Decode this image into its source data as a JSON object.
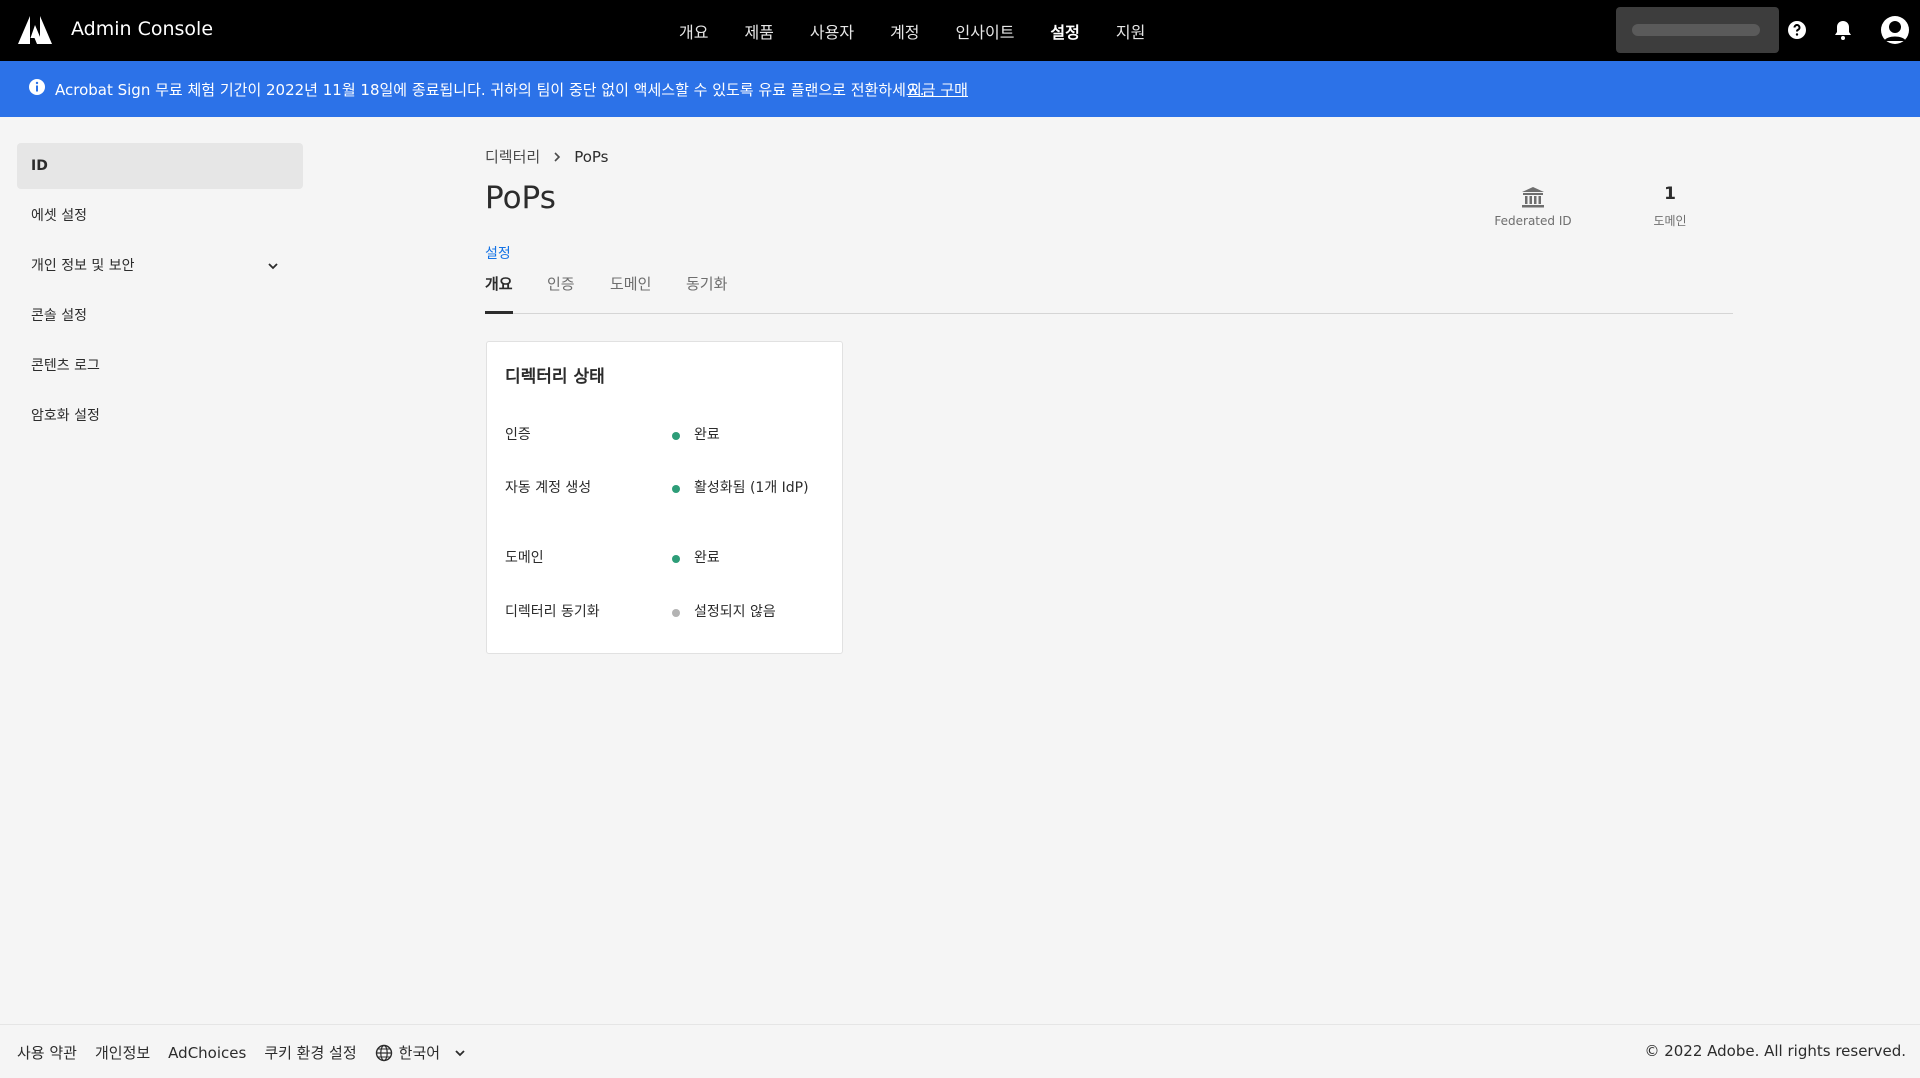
{
  "header": {
    "app_title": "Admin Console",
    "nav": [
      "개요",
      "제품",
      "사용자",
      "계정",
      "인사이트",
      "설정",
      "지원"
    ],
    "active_nav_index": 5
  },
  "banner": {
    "text": "Acrobat Sign 무료 체험 기간이 2022년 11월 18일에 종료됩니다. 귀하의 팀이 중단 없이 액세스할 수 있도록 유료 플랜으로 전환하세요.",
    "link": "지금 구매",
    "color": "#2c72e8"
  },
  "sidebar": {
    "items": [
      {
        "label": "ID",
        "active": true
      },
      {
        "label": "에셋 설정"
      },
      {
        "label": "개인 정보 및 보안",
        "expandable": true
      },
      {
        "label": "콘솔 설정"
      },
      {
        "label": "콘텐츠 로그"
      },
      {
        "label": "암호화 설정"
      }
    ]
  },
  "breadcrumb": {
    "parent": "디렉터리",
    "current": "PoPs"
  },
  "page_title": "PoPs",
  "stats": {
    "federated": {
      "label": "Federated ID"
    },
    "domains": {
      "value": "1",
      "label": "도메인"
    }
  },
  "section_link": "설정",
  "tabs": [
    {
      "label": "개요",
      "active": true
    },
    {
      "label": "인증"
    },
    {
      "label": "도메인"
    },
    {
      "label": "동기화"
    }
  ],
  "status_card": {
    "title": "디렉터리 상태",
    "rows": [
      {
        "label": "인증",
        "status": "완료",
        "state": "ok"
      },
      {
        "label": "자동 계정 생성",
        "status": "활성화됨 (1개 IdP)",
        "state": "ok"
      },
      {
        "label": "도메인",
        "status": "완료",
        "state": "ok"
      },
      {
        "label": "디렉터리 동기화",
        "status": "설정되지 않음",
        "state": "none"
      }
    ],
    "colors": {
      "ok": "#2d9d78",
      "none": "#b3b3b3"
    }
  },
  "footer": {
    "links": [
      "사용 약관",
      "개인정보",
      "AdChoices",
      "쿠키 환경 설정"
    ],
    "language": "한국어",
    "copyright": "© 2022 Adobe. All rights reserved."
  }
}
